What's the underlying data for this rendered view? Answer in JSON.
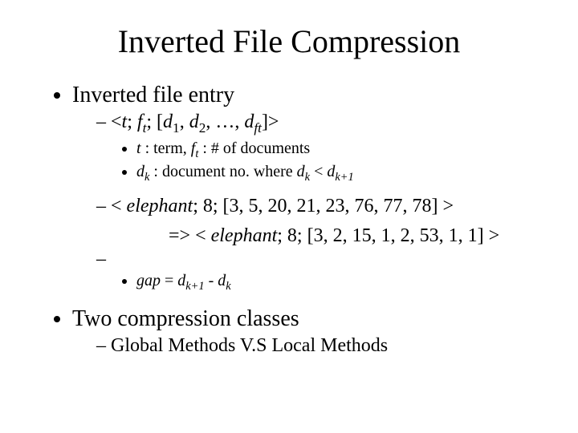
{
  "title": "Inverted File Compression",
  "bullets": {
    "b1": "Inverted file entry",
    "b1_sub1_prefix": "<",
    "b1_sub1_t": "t",
    "b1_sub1_sep1": "; ",
    "b1_sub1_f": "f",
    "b1_sub1_ft_sub": "t",
    "b1_sub1_sep2": "; [",
    "b1_sub1_d": "d",
    "b1_sub1_d1_sub": "1",
    "b1_sub1_c1": ", ",
    "b1_sub1_d2": "d",
    "b1_sub1_d2_sub": "2",
    "b1_sub1_c2": ", …, ",
    "b1_sub1_dft": "d",
    "b1_sub1_dft_sub": "ft",
    "b1_sub1_suffix": "]>",
    "b1_sub1_note1a": "t",
    "b1_sub1_note1b": " : term,  ",
    "b1_sub1_note1c": "f",
    "b1_sub1_note1c_sub": "t",
    "b1_sub1_note1d": " : # of documents",
    "b1_sub1_note2a": "d",
    "b1_sub1_note2a_sub": "k",
    "b1_sub1_note2b": " : document no. where ",
    "b1_sub1_note2c": "d",
    "b1_sub1_note2c_sub": "k",
    "b1_sub1_note2d": " < ",
    "b1_sub1_note2e": "d",
    "b1_sub1_note2e_sub": "k+1",
    "b1_sub2a": "< ",
    "b1_sub2b": "elephant",
    "b1_sub2c": "; 8; [3, 5, 20, 21, 23, 76, 77, 78] >",
    "b1_sub2_next_a": "=> < ",
    "b1_sub2_next_b": "elephant",
    "b1_sub2_next_c": "; 8; [3, 2, 15, 1, 2, 53, 1, 1] >",
    "b1_sub2_note_a": "gap",
    "b1_sub2_note_b": " = ",
    "b1_sub2_note_c": "d",
    "b1_sub2_note_c_sub": "k+1",
    "b1_sub2_note_d": " - ",
    "b1_sub2_note_e": "d",
    "b1_sub2_note_e_sub": "k",
    "b2": "Two compression classes",
    "b2_sub1": "Global Methods  V.S  Local Methods"
  }
}
